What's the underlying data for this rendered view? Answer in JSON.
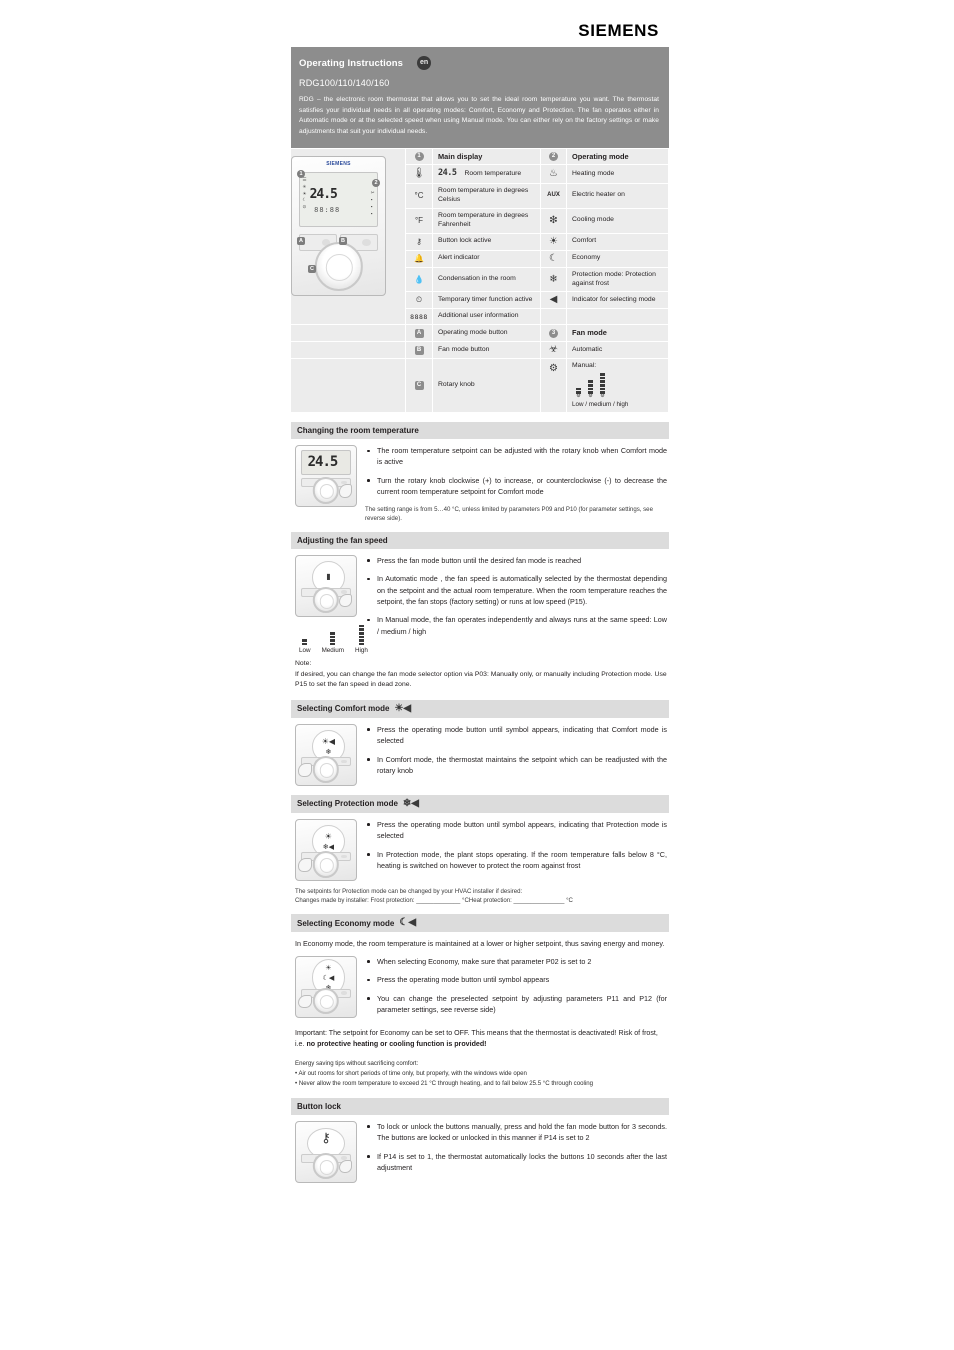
{
  "brand": "SIEMENS",
  "header": {
    "title": "Operating Instructions",
    "language_badge": "en",
    "model": "RDG100/110/140/160",
    "description": "RDG – the electronic room thermostat that allows you to set the ideal room temperature you want. The thermostat satisfies your individual needs in all operating modes: Comfort, Economy and Protection. The fan operates either in Automatic mode or at the selected speed when using Manual mode. You can either rely on the factory settings or make adjustments that suit your individual needs."
  },
  "legend": {
    "device_value": "24.5",
    "device_sub": "88:88",
    "col1_header": {
      "num": "1",
      "label": "Main display"
    },
    "col2_header": {
      "num": "2",
      "label": "Operating mode"
    },
    "col3_header": {
      "num": "3",
      "label": "Fan mode"
    },
    "main_display_rows": [
      {
        "icon": "thermometer-icon",
        "glyph": "🌡",
        "value": "24.5",
        "label": "Room temperature"
      },
      {
        "icon": "celsius-icon",
        "glyph": "°C",
        "label": "Room temperature in degrees Celsius"
      },
      {
        "icon": "fahrenheit-icon",
        "glyph": "°F",
        "label": "Room temperature in degrees Fahrenheit"
      },
      {
        "icon": "key-lock-icon",
        "glyph": "⚷",
        "label": "Button lock active"
      },
      {
        "icon": "bell-alert-icon",
        "glyph": "🔔",
        "label": "Alert indicator"
      },
      {
        "icon": "condensation-drop-icon",
        "glyph": "💧",
        "label": "Condensation in the room"
      },
      {
        "icon": "timer-icon",
        "glyph": "⏲",
        "label": "Temporary timer function active"
      },
      {
        "icon": "seven-segment-icon",
        "glyph": "8888",
        "label": "Additional user information"
      }
    ],
    "operating_mode_rows": [
      {
        "icon": "heating-icon",
        "glyph": "♨",
        "label": "Heating mode"
      },
      {
        "icon": "electric-heater-icon",
        "glyph": "AUX",
        "label": "Electric heater on"
      },
      {
        "icon": "cooling-snowflake-icon",
        "glyph": "❅",
        "label": "Cooling mode"
      },
      {
        "icon": "comfort-sun-icon",
        "glyph": "☀",
        "label": "Comfort"
      },
      {
        "icon": "economy-moon-icon",
        "glyph": "☾",
        "label": "Economy"
      },
      {
        "icon": "protection-frost-icon",
        "glyph": "❄",
        "label": "Protection mode: Protection against frost"
      },
      {
        "icon": "mode-selector-arrow-icon",
        "glyph": "◀",
        "label": "Indicator for selecting mode"
      }
    ],
    "fan_mode_rows": [
      {
        "icon": "fan-automatic-icon",
        "glyph": "☸",
        "label": "Automatic"
      },
      {
        "icon": "fan-manual-icon",
        "glyph": "☸",
        "label": "Manual:"
      }
    ],
    "fan_manual_caption": "Low / medium / high",
    "fan_manual_levels": [
      "Low",
      "medium",
      "high"
    ],
    "control_rows": [
      {
        "badge": "A",
        "label": "Operating mode button"
      },
      {
        "badge": "B",
        "label": "Fan mode button"
      },
      {
        "badge": "C",
        "label": "Rotary knob"
      }
    ]
  },
  "sections": [
    {
      "id": "changing-room-temperature",
      "title": "Changing the room temperature",
      "title_icon": null,
      "device_value": "24.5",
      "bullets": [
        "The room temperature setpoint can be adjusted with the rotary knob when Comfort mode  is active",
        "Turn the rotary knob clockwise (+) to increase, or counterclockwise (-) to decrease the current room temperature setpoint for Comfort mode"
      ],
      "fine_print": "The setting range is from 5…40 °C, unless limited by parameters P09 and P10 (for parameter settings, see reverse side)."
    },
    {
      "id": "adjusting-fan-speed",
      "title": "Adjusting the fan speed",
      "bullets": [
        "Press the fan mode button until the desired fan mode is reached",
        "In Automatic mode  , the fan speed is automatically selected by the thermostat depending on the setpoint and the actual room temperature. When the room temperature reaches the setpoint, the fan stops (factory setting) or runs at low speed (P15).",
        "In Manual mode, the fan operates independently and always runs at the same speed: Low / medium / high"
      ],
      "fan_labels": [
        "Low",
        "Medium",
        "High"
      ],
      "note_title": "Note:",
      "note_text": "If desired, you can change the fan mode selector option via P03: Manually only, or manually including Protection mode. Use P15 to set the fan speed in dead zone."
    },
    {
      "id": "selecting-comfort-mode",
      "title": "Selecting Comfort mode",
      "title_icon": "comfort-sun-icon",
      "bullets": [
        "Press the operating mode button until symbol  appears, indicating that Comfort mode is selected",
        "In Comfort mode, the thermostat maintains the setpoint which can be readjusted with the rotary knob"
      ]
    },
    {
      "id": "selecting-protection-mode",
      "title": "Selecting Protection mode",
      "title_icon": "protection-frost-icon",
      "bullets": [
        "Press the operating mode button until symbol  appears, indicating that Protection mode is selected",
        "In Protection mode, the plant stops operating. If the room temperature falls below 8 °C, heating is switched on however to protect the room against frost"
      ],
      "footnote_line1": "The setpoints for Protection mode can be changed by your HVAC installer if desired:",
      "footnote_line2": "Changes made by installer:          Frost protection: _____________ °CHeat protection: _______________ °C"
    },
    {
      "id": "selecting-economy-mode",
      "title": "Selecting Economy mode",
      "title_icon": "economy-moon-icon",
      "intro": "In Economy mode, the room temperature is maintained at a lower or higher setpoint, thus saving energy and money.",
      "bullets": [
        "When selecting Economy, make sure that parameter P02 is set to 2",
        "Press the operating mode button until symbol  appears",
        "You can change the preselected setpoint by adjusting parameters P11 and P12 (for parameter settings, see reverse side)"
      ],
      "important_prefix": "Important: The setpoint for Economy can be set to OFF. This means that the thermostat is deactivated! Risk of frost, i.e. ",
      "important_bold": "no protective heating or cooling function is provided!",
      "tips_title": "Energy saving tips without sacrificing comfort:",
      "tips": [
        "• Air out rooms for short periods of time only, but properly, with the windows wide open",
        "• Never allow the room temperature to exceed 21 °C through heating, and to fall below 25.5 °C through cooling"
      ]
    },
    {
      "id": "button-lock",
      "title": "Button lock",
      "bullets": [
        "To lock or unlock the buttons manually, press and hold the fan mode button for 3 seconds. The buttons are locked or unlocked in this manner if P14 is set to 2",
        "If P14 is set to 1, the thermostat automatically locks the buttons 10 seconds after the last adjustment"
      ]
    }
  ],
  "colors": {
    "intro_bg": "#8d8d8d",
    "legend_bg": "#ececec",
    "section_head_bg": "#dcdcdc",
    "text": "#231f20"
  }
}
